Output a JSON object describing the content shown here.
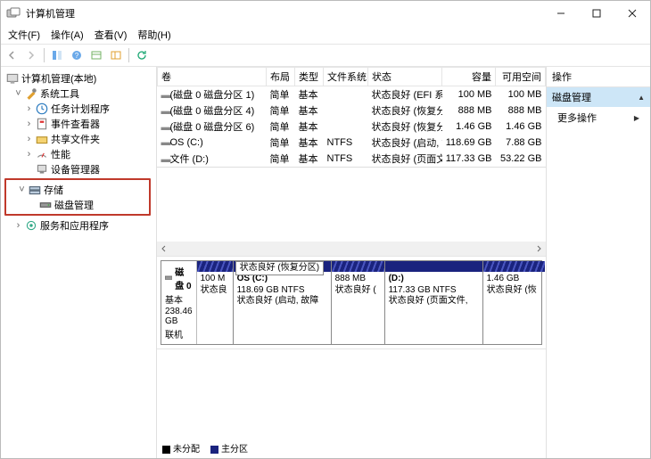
{
  "title": "计算机管理",
  "menu": [
    "文件(F)",
    "操作(A)",
    "查看(V)",
    "帮助(H)"
  ],
  "tree": {
    "root": "计算机管理(本地)",
    "sys": "系统工具",
    "sys_items": [
      "任务计划程序",
      "事件查看器",
      "共享文件夹",
      "性能",
      "设备管理器"
    ],
    "storage": "存储",
    "diskmgmt": "磁盘管理",
    "services": "服务和应用程序"
  },
  "columns": [
    "卷",
    "布局",
    "类型",
    "文件系统",
    "状态",
    "容量",
    "可用空间"
  ],
  "volumes": [
    {
      "name": "(磁盘 0 磁盘分区 1)",
      "layout": "简单",
      "type": "基本",
      "fs": "",
      "status": "状态良好 (EFI 系统分区)",
      "cap": "100 MB",
      "free": "100 MB"
    },
    {
      "name": "(磁盘 0 磁盘分区 4)",
      "layout": "简单",
      "type": "基本",
      "fs": "",
      "status": "状态良好 (恢复分区)",
      "cap": "888 MB",
      "free": "888 MB"
    },
    {
      "name": "(磁盘 0 磁盘分区 6)",
      "layout": "简单",
      "type": "基本",
      "fs": "",
      "status": "状态良好 (恢复分区)",
      "cap": "1.46 GB",
      "free": "1.46 GB"
    },
    {
      "name": "OS (C:)",
      "layout": "简单",
      "type": "基本",
      "fs": "NTFS",
      "status": "状态良好 (启动, 故障转储, 主分区)",
      "cap": "118.69 GB",
      "free": "7.88 GB"
    },
    {
      "name": "文件 (D:)",
      "layout": "简单",
      "type": "基本",
      "fs": "NTFS",
      "status": "状态良好 (页面文件, 主分区)",
      "cap": "117.33 GB",
      "free": "53.22 GB"
    }
  ],
  "disk": {
    "label": "磁盘 0",
    "type": "基本",
    "size": "238.46 GB",
    "state": "联机",
    "parts": [
      {
        "l1": "",
        "l2": "100 M",
        "l3": "状态良",
        "w": 40,
        "bar": "stripe"
      },
      {
        "l1": "OS  (C:)",
        "l2": "118.69 GB NTFS",
        "l3": "状态良好 (启动, 故障",
        "w": 110,
        "bar": "solid",
        "tooltip": "状态良好 (恢复分区)"
      },
      {
        "l1": "",
        "l2": "888 MB",
        "l3": "状态良好 (",
        "w": 60,
        "bar": "stripe"
      },
      {
        "l1": "(D:)",
        "l2": "117.33 GB NTFS",
        "l3": "状态良好 (页面文件, ",
        "w": 110,
        "bar": "solid"
      },
      {
        "l1": "",
        "l2": "1.46 GB",
        "l3": "状态良好 (恢",
        "w": 70,
        "bar": "stripe"
      }
    ]
  },
  "legend": {
    "unalloc": "未分配",
    "primary": "主分区"
  },
  "actions": {
    "header": "操作",
    "selected": "磁盘管理",
    "more": "更多操作"
  }
}
